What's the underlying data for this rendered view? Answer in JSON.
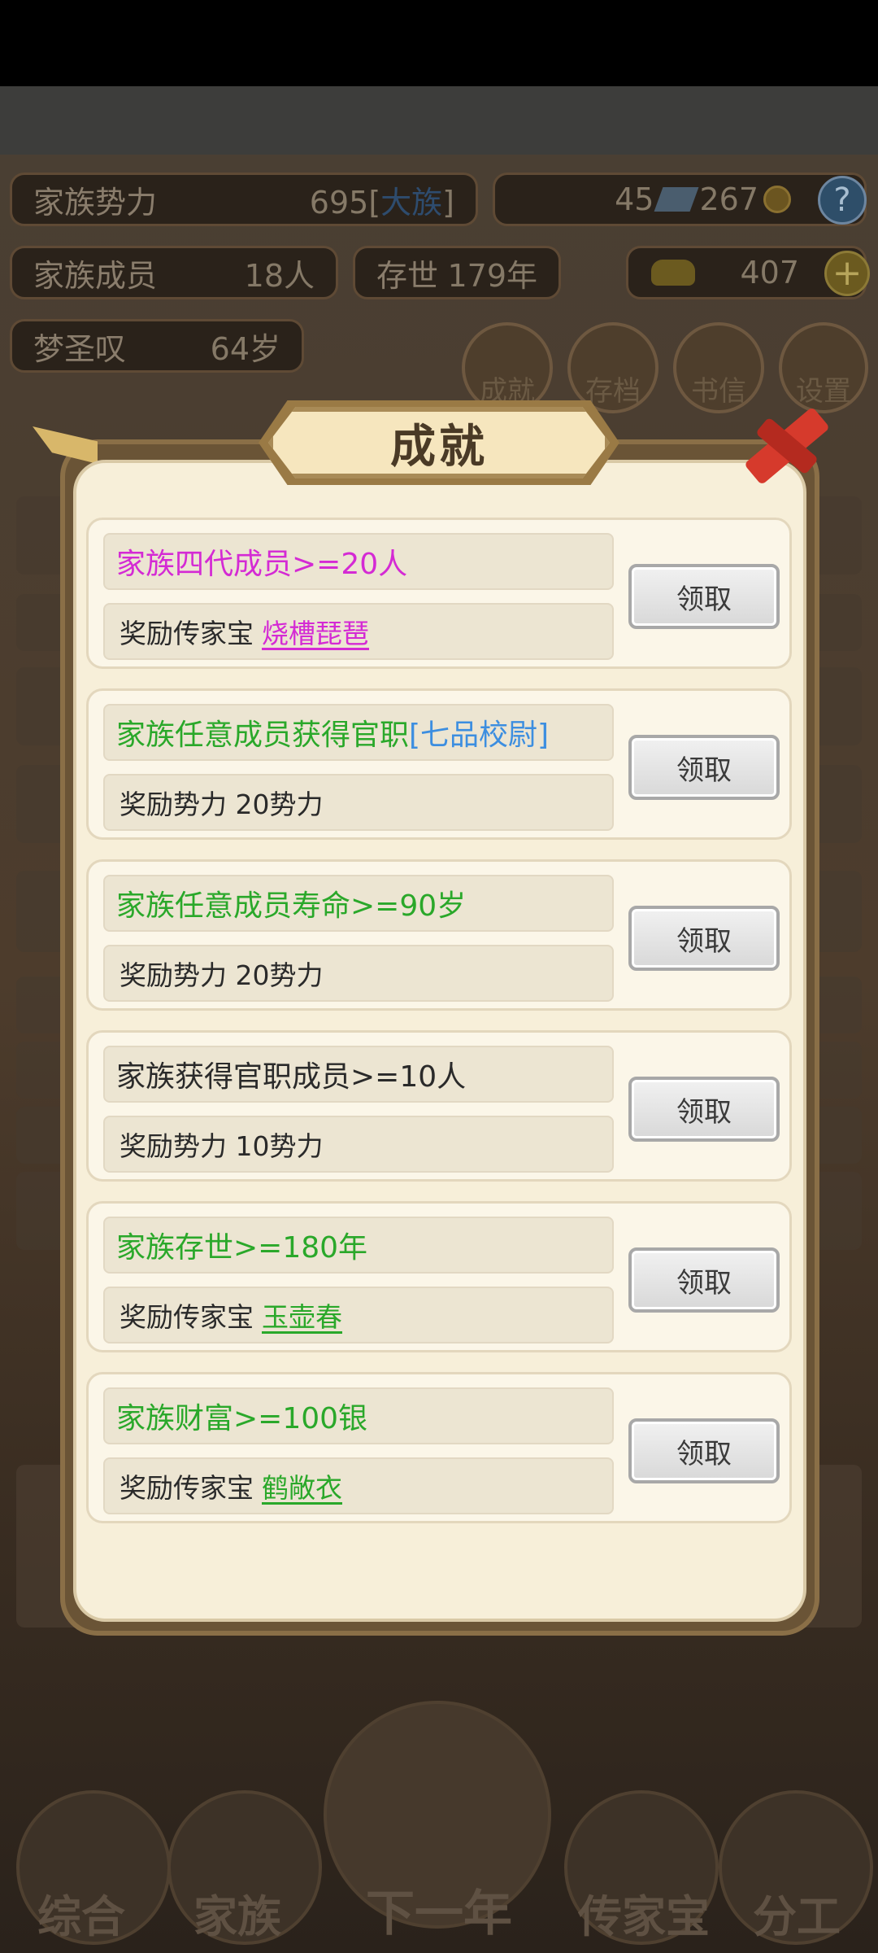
{
  "header": {
    "family_power_label": "家族势力",
    "family_power_value": "695",
    "family_rank": "大族",
    "books_count": "45",
    "coins_count": "267",
    "members_label": "家族成员",
    "members_value": "18人",
    "age_label": "存世",
    "age_value": "179年",
    "gold_value": "407",
    "leader_name": "梦圣叹",
    "leader_age": "64岁",
    "help_icon_glyph": "?"
  },
  "top_buttons": [
    {
      "label": "成就",
      "icon": "achievement-icon"
    },
    {
      "label": "存档",
      "icon": "save-icon"
    },
    {
      "label": "书信",
      "icon": "letter-icon"
    },
    {
      "label": "设置",
      "icon": "settings-icon"
    }
  ],
  "modal": {
    "title": "成就",
    "achievements": [
      {
        "condition": "家族四代成员>=20人",
        "condition_color": "magenta",
        "condition_extra": "",
        "reward_prefix": "奖励传家宝",
        "reward_item": "烧槽琵琶",
        "reward_item_color": "magenta",
        "claim_label": "领取"
      },
      {
        "condition": "家族任意成员获得官职",
        "condition_color": "green",
        "condition_extra": "[七品校尉]",
        "reward_prefix": "奖励势力 20势力",
        "reward_item": "",
        "reward_item_color": "",
        "claim_label": "领取"
      },
      {
        "condition": "家族任意成员寿命>=90岁",
        "condition_color": "green",
        "condition_extra": "",
        "reward_prefix": "奖励势力 20势力",
        "reward_item": "",
        "reward_item_color": "",
        "claim_label": "领取"
      },
      {
        "condition": "家族获得官职成员>=10人",
        "condition_color": "dark",
        "condition_extra": "",
        "reward_prefix": "奖励势力 10势力",
        "reward_item": "",
        "reward_item_color": "",
        "claim_label": "领取"
      },
      {
        "condition": "家族存世>=180年",
        "condition_color": "green",
        "condition_extra": "",
        "reward_prefix": "奖励传家宝",
        "reward_item": "玉壶春",
        "reward_item_color": "green",
        "claim_label": "领取"
      },
      {
        "condition": "家族财富>=100银",
        "condition_color": "green",
        "condition_extra": "",
        "reward_prefix": "奖励传家宝",
        "reward_item": "鹤敞衣",
        "reward_item_color": "green",
        "claim_label": "领取"
      }
    ]
  },
  "bottom_nav": [
    {
      "label": "综合"
    },
    {
      "label": "家族"
    },
    {
      "label": "下一年"
    },
    {
      "label": "传家宝"
    },
    {
      "label": "分工"
    }
  ],
  "colors": {
    "magenta": "#d42ad4",
    "green": "#2aa82a",
    "blue": "#3c8ee0",
    "dark": "#2a2a2a"
  }
}
